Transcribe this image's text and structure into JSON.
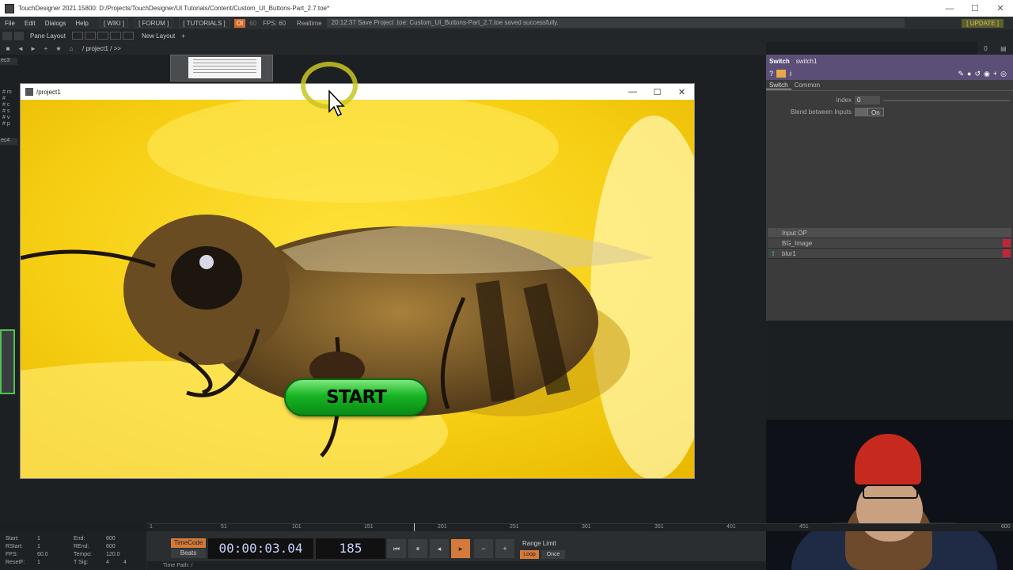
{
  "app": {
    "window_title": "TouchDesigner 2021.15800: D:/Projects/TouchDesigner/UI Tutorials/Content/Custom_UI_Buttons-Part_2.7.toe*"
  },
  "menu": {
    "items": [
      "File",
      "Edit",
      "Dialogs",
      "Help"
    ],
    "wiki": "[ WIKI ]",
    "forum": "[ FORUM ]",
    "tutorials": "[ TUTORIALS ]",
    "oi": "OI",
    "fps_value_dim": "60",
    "fps_label": "FPS:  60",
    "realtime": "Realtime",
    "status_message": "20:12:37 Save Project .toe: Custom_UI_Buttons-Part_2.7.toe saved successfully.",
    "update": "[ UPDATE ]"
  },
  "panebar": {
    "pane_layout": "Pane Layout",
    "new_layout": "New Layout"
  },
  "pathbar": {
    "path": "/  project1  /  >>",
    "right_a": "0",
    "right_b": "▤"
  },
  "network": {
    "node_left_1": "ec3",
    "node_left_2": "ec4",
    "text_dat_lines": [
      "# m",
      "#",
      "# c",
      "# s",
      "# v",
      "# p"
    ]
  },
  "preview_window": {
    "title": "/project1",
    "minimize": "—",
    "maximize": "☐",
    "close": "✕",
    "start_button": "START"
  },
  "param": {
    "op_type": "Switch",
    "op_name": "switch1",
    "help_icon": "?",
    "info_icon": "i",
    "right_icons": "✎●↺◉+◎",
    "tabs": [
      "Switch",
      "Common"
    ],
    "index_label": "Index",
    "index_value": "0",
    "blend_label": "Blend between Inputs",
    "blend_value": "On",
    "inputs_header": "Input OP",
    "inputs": [
      "BG_Image",
      "blur1"
    ]
  },
  "timeline": {
    "ruler_ticks": [
      "1",
      "51",
      "101",
      "151",
      "201",
      "251",
      "301",
      "351",
      "401",
      "451",
      "600"
    ],
    "start_label": "Start:",
    "start_value": "1",
    "end_label": "End:",
    "end_value": "600",
    "rstart_label": "RStart:",
    "rstart_value": "1",
    "rend_label": "REnd:",
    "rend_value": "600",
    "fps_label": "FPS:",
    "fps_value": "60.0",
    "tempo_label": "Tempo:",
    "tempo_value": "120.0",
    "resetf_label": "ResetF:",
    "resetf_value": "1",
    "tsig_label": "T Sig:",
    "tsig_value_a": "4",
    "tsig_value_b": "4",
    "timecode_btn": "TimeCode",
    "beats_btn": "Beats",
    "timecode": "00:00:03.04",
    "frame": "185",
    "range_limit": "Range Limit",
    "loop": "Loop",
    "once": "Once",
    "time_path": "Time Path: /"
  },
  "colors": {
    "accent_orange": "#d47a3a",
    "param_header": "#5b4f77",
    "start_green": "#18b424"
  }
}
